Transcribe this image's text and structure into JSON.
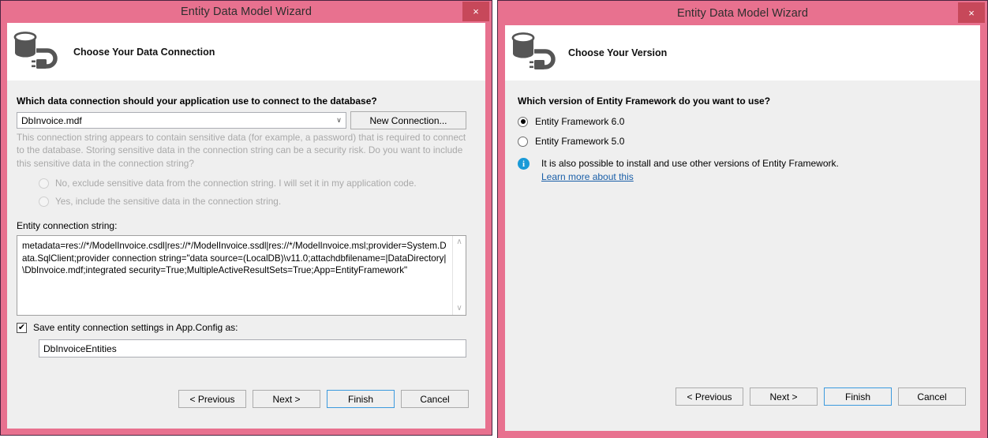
{
  "colors": {
    "window_chrome": "#e8718f",
    "window_border": "#4a2540",
    "close_button": "#c7485a",
    "client_bg": "#efefef",
    "banner_bg": "#ffffff",
    "focus_border": "#3c9ade",
    "info_blue": "#1a9ad7",
    "link_blue": "#1a5fa8",
    "disabled_text": "#a9a9a9"
  },
  "dialog_left": {
    "title": "Entity Data Model Wizard",
    "close_glyph": "×",
    "banner": {
      "heading": "Choose Your Data Connection",
      "icon": "database-plug-icon"
    },
    "question": "Which data connection should your application use to connect to the database?",
    "connection_combo": {
      "value": "DbInvoice.mdf",
      "arrow_glyph": "∨"
    },
    "new_connection_button": "New Connection...",
    "sensitive_note": "This connection string appears to contain sensitive data (for example, a password) that is required to connect to the database. Storing sensitive data in the connection string can be a security risk. Do you want to include this sensitive data in the connection string?",
    "sensitive_options": [
      {
        "label": "No, exclude sensitive data from the connection string. I will set it in my application code.",
        "selected": false,
        "disabled": true
      },
      {
        "label": "Yes, include the sensitive data in the connection string.",
        "selected": false,
        "disabled": true
      }
    ],
    "conn_string_label": "Entity connection string:",
    "conn_string_value": "metadata=res://*/ModelInvoice.csdl|res://*/ModelInvoice.ssdl|res://*/ModelInvoice.msl;provider=System.Data.SqlClient;provider connection string=\"data source=(LocalDB)\\v11.0;attachdbfilename=|DataDirectory|\\DbInvoice.mdf;integrated security=True;MultipleActiveResultSets=True;App=EntityFramework\"",
    "scroll_up_glyph": "∧",
    "scroll_down_glyph": "∨",
    "save_checkbox": {
      "label": "Save entity connection settings in App.Config as:",
      "checked": true,
      "glyph": "✔"
    },
    "app_config_name": "DbInvoiceEntities",
    "buttons": [
      {
        "label": "< Previous",
        "focused": false
      },
      {
        "label": "Next >",
        "focused": false
      },
      {
        "label": "Finish",
        "focused": true
      },
      {
        "label": "Cancel",
        "focused": false
      }
    ]
  },
  "dialog_right": {
    "title": "Entity Data Model Wizard",
    "close_glyph": "×",
    "banner": {
      "heading": "Choose Your Version",
      "icon": "database-plug-icon"
    },
    "question": "Which version of Entity Framework do you want to use?",
    "version_options": [
      {
        "label": "Entity Framework 6.0",
        "selected": true
      },
      {
        "label": "Entity Framework 5.0",
        "selected": false
      }
    ],
    "info": {
      "icon_glyph": "i",
      "text": "It is also possible to install and use other versions of Entity Framework.",
      "link": "Learn more about this"
    },
    "buttons": [
      {
        "label": "< Previous",
        "focused": false
      },
      {
        "label": "Next >",
        "focused": false
      },
      {
        "label": "Finish",
        "focused": true
      },
      {
        "label": "Cancel",
        "focused": false
      }
    ]
  }
}
